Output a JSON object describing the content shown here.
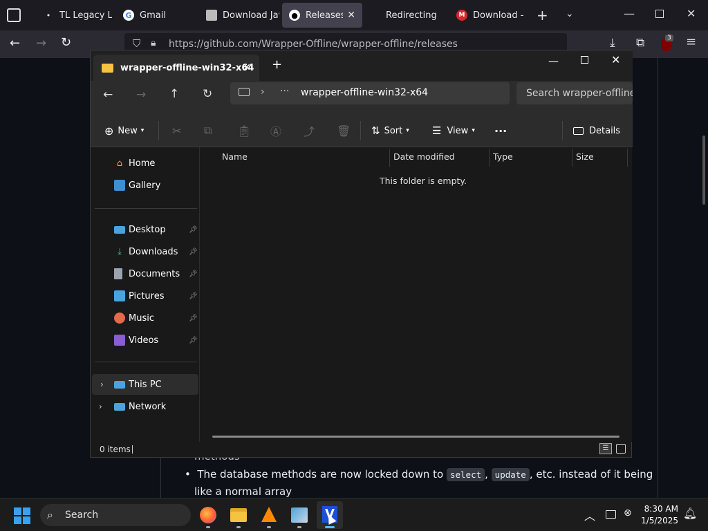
{
  "browser": {
    "tabs": [
      {
        "label": "TL Legacy Lau",
        "icon": "dot-icon"
      },
      {
        "label": "Gmail",
        "icon": "google-icon"
      },
      {
        "label": "Download Jav",
        "icon": "page-icon"
      },
      {
        "label": "Releases · w",
        "icon": "github-icon"
      },
      {
        "label": "Redirecting",
        "icon": "none"
      },
      {
        "label": "Download - M",
        "icon": "mega-icon"
      }
    ],
    "url": "https://github.com/Wrapper-Offline/wrapper-offline/releases",
    "extension_badge": "3"
  },
  "github": {
    "fragment": "methods",
    "bullet_prefix": "The database methods are now locked down to",
    "code1": "select",
    "code2": "update",
    "bullet_suffix": ", etc. instead of it being",
    "bullet_line2": "like a normal array"
  },
  "explorer": {
    "tab_title": "wrapper-offline-win32-x64",
    "address": "wrapper-offline-win32-x64",
    "search_placeholder": "Search wrapper-offline-w",
    "toolbar": {
      "new_label": "New",
      "sort_label": "Sort",
      "view_label": "View",
      "details_label": "Details"
    },
    "nav": {
      "home": "Home",
      "gallery": "Gallery",
      "desktop": "Desktop",
      "downloads": "Downloads",
      "documents": "Documents",
      "pictures": "Pictures",
      "music": "Music",
      "videos": "Videos",
      "this_pc": "This PC",
      "network": "Network"
    },
    "columns": {
      "name": "Name",
      "date": "Date modified",
      "type": "Type",
      "size": "Size"
    },
    "empty_message": "This folder is empty.",
    "status": "0 items"
  },
  "taskbar": {
    "search_label": "Search",
    "time": "8:30 AM",
    "date": "1/5/2025"
  }
}
